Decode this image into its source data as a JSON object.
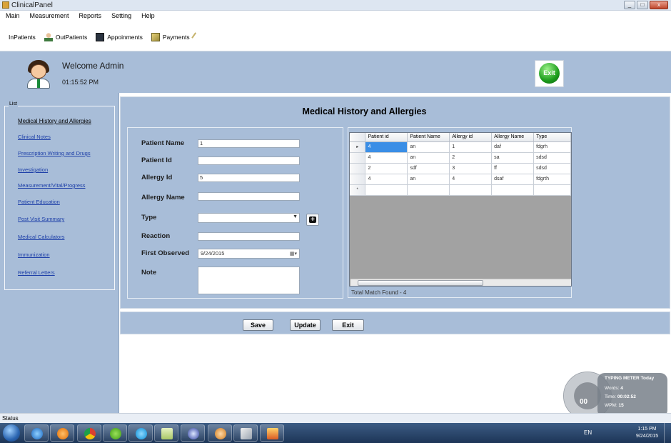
{
  "window": {
    "title": "ClinicalPanel",
    "min": "_",
    "max": "□",
    "close": "x"
  },
  "menu": [
    "Main",
    "Measurement",
    "Reports",
    "Setting",
    "Help"
  ],
  "toolbar": [
    {
      "label": "InPatients",
      "icon": "none"
    },
    {
      "label": "OutPatients",
      "icon": "person-icon"
    },
    {
      "label": "Appoinments",
      "icon": "book-icon"
    },
    {
      "label": "Payments",
      "icon": "payment-icon"
    }
  ],
  "header": {
    "welcome": "Welcome Admin",
    "time": "01:15:52 PM",
    "exit_label": "Exit"
  },
  "sidebar": {
    "legend": "List",
    "items": [
      "Medical History and Allergies",
      "Clinical Notes",
      "Prescription Writing and Drugs",
      "Investigation",
      "Measurement/Vital/Progress",
      "Patient Education",
      "Post Visit Summary",
      "Medical Calculators",
      "Immunization",
      "Referral Letters"
    ]
  },
  "page": {
    "title": "Medical History and Allergies"
  },
  "form": {
    "patient_name_label": "Patient Name",
    "patient_name_value": "1",
    "patient_id_label": "Patient Id",
    "patient_id_value": "",
    "allergy_id_label": "Allergy Id",
    "allergy_id_value": "5",
    "allergy_name_label": "Allergy Name",
    "allergy_name_value": "",
    "type_label": "Type",
    "type_value": "",
    "reaction_label": "Reaction",
    "reaction_value": "",
    "first_observed_label": "First Observed",
    "first_observed_value": "9/24/2015",
    "note_label": "Note",
    "note_value": ""
  },
  "grid": {
    "columns": [
      "Patient id",
      "Patient Name",
      "Allergy id",
      "Allergy Name",
      "Type"
    ],
    "rows": [
      [
        "4",
        "an",
        "1",
        "daf",
        "fdgrh"
      ],
      [
        "4",
        "an",
        "2",
        "sa",
        "sdsd"
      ],
      [
        "2",
        "sdf",
        "3",
        "ff",
        "sdsd"
      ],
      [
        "4",
        "an",
        "4",
        "dsaf",
        "fdgrth"
      ]
    ],
    "new_row_marker": "*",
    "current_row_marker": "▸",
    "total": "Total Match Found - 4"
  },
  "actions": {
    "save": "Save",
    "update": "Update",
    "exit": "Exit"
  },
  "gauge": {
    "title": "TYPING METER Today",
    "value": "00",
    "words_label": "Words:",
    "words_value": "4",
    "time_label": "Time:",
    "time_value": "00:02:52",
    "wpm_label": "WPM:",
    "wpm_value": "15"
  },
  "status": {
    "text": "Status"
  },
  "taskbar": {
    "lang": "EN",
    "time": "1:15 PM",
    "date": "9/24/2015",
    "apps": [
      "ie-icon",
      "media-player-icon",
      "chrome-icon",
      "utorrent-icon",
      "skype-icon",
      "notepad-icon",
      "app-icon",
      "paint-icon",
      "pen-icon",
      "folder-icon"
    ]
  },
  "colors": {
    "panel": "#a8bdd8",
    "link": "#1d3fa8",
    "selection": "#3a8ee6"
  }
}
